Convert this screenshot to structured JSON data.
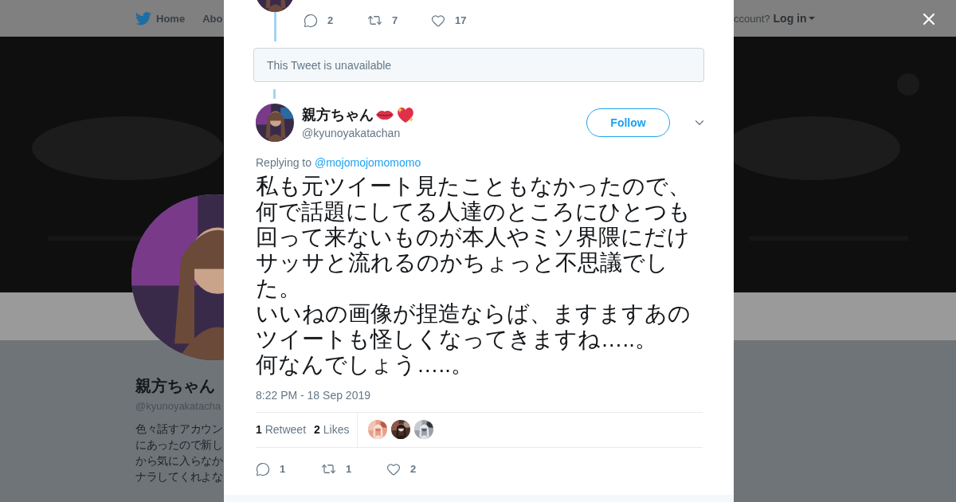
{
  "background_page": {
    "nav": {
      "items": [
        {
          "kind": "home",
          "label": "Home"
        },
        {
          "kind": "plain",
          "label": "Abo"
        }
      ],
      "account_prompt": "ccount?",
      "login": "Log in"
    },
    "profile": {
      "name": "親方ちゃん",
      "handle": "@kyunoyakatacha",
      "bio": [
        "色々話すアカウン",
        "にあったので新し",
        "から気に入らなか",
        "ナラしてくれよな"
      ]
    }
  },
  "modal": {
    "previous_tweet": {
      "actions": [
        {
          "kind": "reply",
          "count": "2"
        },
        {
          "kind": "retweet",
          "count": "7"
        },
        {
          "kind": "like",
          "count": "17"
        }
      ]
    },
    "unavailable_notice": "This Tweet is unavailable",
    "tweet": {
      "name": "親方ちゃん",
      "handle": "@kyunoyakatachan",
      "follow": "Follow",
      "replying_label": "Replying to",
      "replying_to": "@mojomojomomomo",
      "text": [
        "私も元ツイート見たこともなかったので、何で話題にしてる人達のところにひとつも回って来ないものが本人やミソ界隈にだけサッサと流れるのかちょっと不思議でした。",
        "いいねの画像が捏造ならば、ますますあのツイートも怪しくなってきますね…..。",
        "何なんでしょう…..。"
      ],
      "timestamp": "8:22 PM - 18 Sep 2019",
      "stats": [
        {
          "count": "1",
          "label": "Retweet"
        },
        {
          "count": "2",
          "label": "Likes"
        }
      ],
      "likers": [
        {
          "kind": "picture"
        },
        {
          "kind": "picture"
        },
        {
          "kind": "picture"
        }
      ],
      "actions": [
        {
          "kind": "reply",
          "count": "1"
        },
        {
          "kind": "retweet",
          "count": "1"
        },
        {
          "kind": "like",
          "count": "2"
        }
      ]
    }
  }
}
